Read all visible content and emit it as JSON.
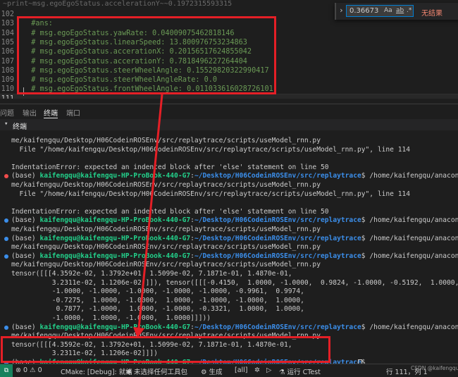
{
  "editor": {
    "top_line": "    ~print~msg.egoEgoStatus.accelerationY~~0.1972315593315",
    "lines": [
      {
        "num": "102",
        "code": ""
      },
      {
        "num": "103",
        "code": "  #ans:"
      },
      {
        "num": "104",
        "code": "  # msg.egoEgoStatus.yawRate: 0.04009075462818146"
      },
      {
        "num": "105",
        "code": "  # msg.egoEgoStatus.linearSpeed: 13.800976753234863"
      },
      {
        "num": "106",
        "code": "  # msg.egoEgoStatus.accerationX: 0.20156517624855042"
      },
      {
        "num": "107",
        "code": "  # msg.egoEgoStatus.accerationY: 0.7818496227264404"
      },
      {
        "num": "108",
        "code": "  # msg.egoEgoStatus.steerWheelAngle: 0.15529820322990417"
      },
      {
        "num": "109",
        "code": "  # msg.egoEgoStatus.steerWheelAngleRate: 0.0"
      },
      {
        "num": "110",
        "code": "  # msg.egoEgoStatus.frontWheelAngle: 0.011033616028726101"
      },
      {
        "num": "111",
        "code": ""
      }
    ]
  },
  "find": {
    "value": "0.36673",
    "match_case": "Aa",
    "whole_word": "ab",
    "regex": ".*",
    "no_results": "无结果"
  },
  "panel": {
    "tabs": [
      "问题",
      "输出",
      "终端",
      "端口"
    ],
    "active_tab": "终端",
    "section_title": "终端"
  },
  "terminal": {
    "lines": [
      {
        "segments": [
          {
            "t": "me/kaifengqu/Desktop/H06CodeinROSEnv/src/replaytrace/scripts/useModel_rnn.py"
          }
        ]
      },
      {
        "segments": [
          {
            "t": "  File \"/home/kaifengqu/Desktop/H06CodeinROSEnv/src/replaytrace/scripts/useModel_rnn.py\", line 114"
          }
        ]
      },
      {
        "segments": [
          {
            "t": ""
          }
        ]
      },
      {
        "segments": [
          {
            "t": "IndentationError: expected an indented block after 'else' statement on line 50"
          }
        ]
      },
      {
        "dot": "#f14c4c",
        "segments": [
          {
            "t": "(base) "
          },
          {
            "t": "kaifengqu@kaifengqu-HP-ProBook-440-G7",
            "c": "u"
          },
          {
            "t": ":"
          },
          {
            "t": "~/Desktop/H06CodeinROSEnv/src/replaytrace",
            "c": "p"
          },
          {
            "t": "$ /home/kaifengqu/anaconda3/bin/python /ho"
          }
        ]
      },
      {
        "segments": [
          {
            "t": "me/kaifengqu/Desktop/H06CodeinROSEnv/src/replaytrace/scripts/useModel_rnn.py"
          }
        ]
      },
      {
        "segments": [
          {
            "t": "  File \"/home/kaifengqu/Desktop/H06CodeinROSEnv/src/replaytrace/scripts/useModel_rnn.py\", line 114"
          }
        ]
      },
      {
        "segments": [
          {
            "t": ""
          }
        ]
      },
      {
        "segments": [
          {
            "t": "IndentationError: expected an indented block after 'else' statement on line 50"
          }
        ]
      },
      {
        "dot": "#3b8eea",
        "segments": [
          {
            "t": "(base) "
          },
          {
            "t": "kaifengqu@kaifengqu-HP-ProBook-440-G7",
            "c": "u"
          },
          {
            "t": ":"
          },
          {
            "t": "~/Desktop/H06CodeinROSEnv/src/replaytrace",
            "c": "p"
          },
          {
            "t": "$ /home/kaifengqu/anaconda3/bin/python /ho"
          }
        ]
      },
      {
        "segments": [
          {
            "t": "me/kaifengqu/Desktop/H06CodeinROSEnv/src/replaytrace/scripts/useModel_rnn.py"
          }
        ]
      },
      {
        "dot": "#3b8eea",
        "segments": [
          {
            "t": "(base) "
          },
          {
            "t": "kaifengqu@kaifengqu-HP-ProBook-440-G7",
            "c": "u"
          },
          {
            "t": ":"
          },
          {
            "t": "~/Desktop/H06CodeinROSEnv/src/replaytrace",
            "c": "p"
          },
          {
            "t": "$ /home/kaifengqu/anaconda3/bin/python /ho"
          }
        ]
      },
      {
        "segments": [
          {
            "t": "me/kaifengqu/Desktop/H06CodeinROSEnv/src/replaytrace/scripts/useModel_rnn.py"
          }
        ]
      },
      {
        "dot": "#3b8eea",
        "segments": [
          {
            "t": "(base) "
          },
          {
            "t": "kaifengqu@kaifengqu-HP-ProBook-440-G7",
            "c": "u"
          },
          {
            "t": ":"
          },
          {
            "t": "~/Desktop/H06CodeinROSEnv/src/replaytrace",
            "c": "p"
          },
          {
            "t": "$ /home/kaifengqu/anaconda3/bin/python /ho"
          }
        ]
      },
      {
        "segments": [
          {
            "t": "me/kaifengqu/Desktop/H06CodeinROSEnv/src/replaytrace/scripts/useModel_rnn.py"
          }
        ]
      },
      {
        "segments": [
          {
            "t": "tensor([[[4.3592e-02, 1.3792e+01, 1.5099e-02, 7.1871e-01, 1.4870e-01,"
          }
        ]
      },
      {
        "segments": [
          {
            "t": "          3.2311e-02, 1.1206e-02]]]), tensor([[[-0.4150,  1.0000, -1.0000,  0.9824, -1.0000, -0.5192,  1.0000,"
          }
        ]
      },
      {
        "segments": [
          {
            "t": "          -1.0000, -1.0000, -1.0000, -1.0000, -1.0000, -0.9961,  0.9974,"
          }
        ]
      },
      {
        "segments": [
          {
            "t": "          -0.7275,  1.0000, -1.0000,  1.0000, -1.0000, -1.0000,  1.0000,"
          }
        ]
      },
      {
        "segments": [
          {
            "t": "           0.7877, -1.0000,  1.0000, -1.0000, -0.3321,  1.0000,  1.0000,"
          }
        ]
      },
      {
        "segments": [
          {
            "t": "          -1.0000,  1.0000, -1.0000,  1.0000]]]))"
          }
        ]
      },
      {
        "dot": "#3b8eea",
        "segments": [
          {
            "t": "(base) "
          },
          {
            "t": "kaifengqu@kaifengqu-HP-ProBook-440-G7",
            "c": "u"
          },
          {
            "t": ":"
          },
          {
            "t": "~/Desktop/H06CodeinROSEnv/src/replaytrace",
            "c": "p"
          },
          {
            "t": "$ /home/kaifengqu/anaconda3/bin/python /ho"
          }
        ]
      },
      {
        "segments": [
          {
            "t": "me/kaifengqu/Desktop/H06CodeinROSEnv/src/replaytrace/scripts/useModel_rnn.py"
          }
        ]
      },
      {
        "segments": [
          {
            "t": "tensor([[[4.3592e-02, 1.3792e+01, 1.5099e-02, 7.1871e-01, 1.4870e-01,"
          }
        ]
      },
      {
        "segments": [
          {
            "t": "          3.2311e-02, 1.1206e-02]]])"
          }
        ]
      },
      {
        "dot": "#3b8eea",
        "segments": [
          {
            "t": "(base) "
          },
          {
            "t": "kaifengqu@kaifengqu-HP-ProBook-440-G7",
            "c": "u"
          },
          {
            "t": ":"
          },
          {
            "t": "~/Desktop/H06CodeinROSEnv/src/replaytrace",
            "c": "p"
          },
          {
            "t": "$ "
          }
        ]
      }
    ]
  },
  "status": {
    "cmake": "CMake: [Debug]: 就绪",
    "kit": "未选择任何工具包",
    "build": "生成",
    "target": "[all]",
    "ctest": "运行 CTest",
    "position": "行 111，列 1",
    "watermark": "CSDN @kaifengqu"
  },
  "colors": {
    "annotation_red": "#e41f26",
    "user_green": "#23d18b",
    "path_blue": "#3b8eea",
    "comment_green": "#6a9955"
  }
}
